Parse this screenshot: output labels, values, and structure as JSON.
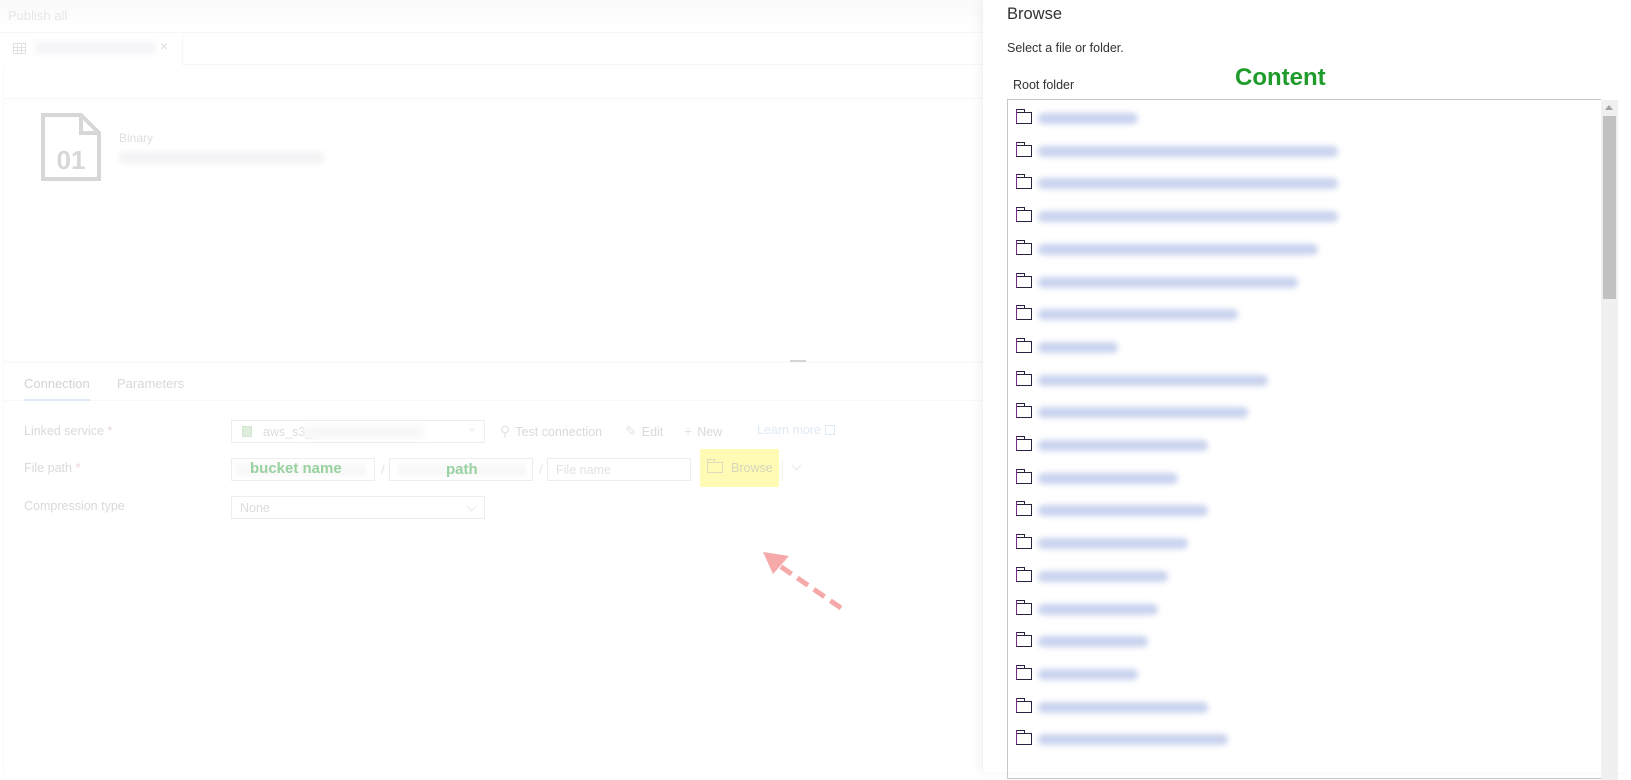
{
  "topbar": {
    "publish_all": "Publish all"
  },
  "document_tab": {
    "icon": "table-icon",
    "close": "×"
  },
  "dataset": {
    "type": "Binary",
    "icon": "binary-file-icon",
    "icon_text": "01"
  },
  "tabs": [
    {
      "label": "Connection",
      "active": true
    },
    {
      "label": "Parameters",
      "active": false
    }
  ],
  "form": {
    "linked_service": {
      "label": "Linked service",
      "required": "*",
      "value": "aws_s3_"
    },
    "file_path": {
      "label": "File path",
      "required": "*",
      "bucket_annotation": "bucket name",
      "path_annotation": "path",
      "separator": "/",
      "filename_placeholder": "File name"
    },
    "compression": {
      "label": "Compression type",
      "value": "None"
    }
  },
  "actions": {
    "test_connection": "Test connection",
    "edit": "Edit",
    "new": "New",
    "learn_more": "Learn more",
    "browse": "Browse"
  },
  "annotation_colors": {
    "highlight": "#fff65a",
    "label_green": "#1a9a2b",
    "arrow_red": "#e8423f"
  },
  "browse_panel": {
    "title": "Browse",
    "subtitle": "Select a file or folder.",
    "root_label": "Root folder",
    "content_annotation": "Content",
    "items_redacted": true,
    "item_count_visible": 20
  }
}
